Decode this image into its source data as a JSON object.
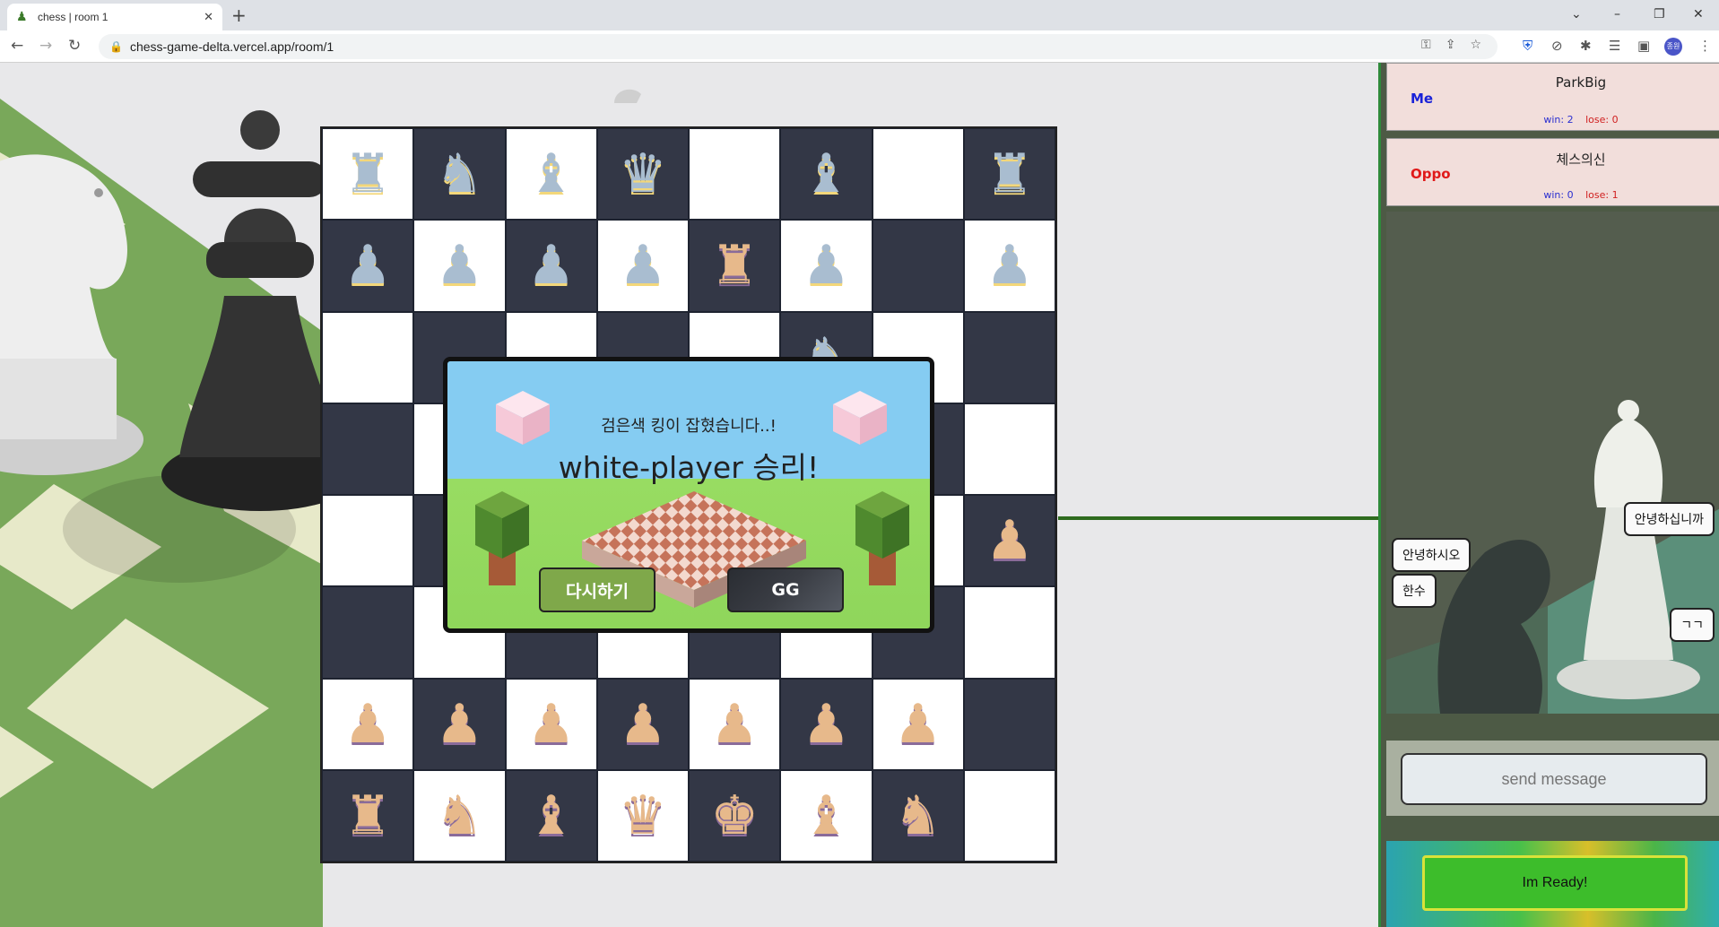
{
  "browser": {
    "tab_title": "chess | room 1",
    "url": "chess-game-delta.vercel.app/room/1",
    "avatar_text": "종원"
  },
  "board": {
    "rows": [
      [
        {
          "p": "♜",
          "c": "black"
        },
        {
          "p": "♞",
          "c": "black"
        },
        {
          "p": "♝",
          "c": "black"
        },
        {
          "p": "♛",
          "c": "black"
        },
        {
          "p": "",
          "c": ""
        },
        {
          "p": "♝",
          "c": "black"
        },
        {
          "p": "",
          "c": ""
        },
        {
          "p": "♜",
          "c": "black"
        }
      ],
      [
        {
          "p": "♟",
          "c": "black"
        },
        {
          "p": "♟",
          "c": "black"
        },
        {
          "p": "♟",
          "c": "black"
        },
        {
          "p": "♟",
          "c": "black"
        },
        {
          "p": "♜",
          "c": "white"
        },
        {
          "p": "♟",
          "c": "black"
        },
        {
          "p": "",
          "c": ""
        },
        {
          "p": "♟",
          "c": "black"
        }
      ],
      [
        {
          "p": "",
          "c": ""
        },
        {
          "p": "",
          "c": ""
        },
        {
          "p": "",
          "c": ""
        },
        {
          "p": "",
          "c": ""
        },
        {
          "p": "",
          "c": ""
        },
        {
          "p": "♞",
          "c": "black"
        },
        {
          "p": "",
          "c": ""
        },
        {
          "p": "",
          "c": ""
        }
      ],
      [
        {
          "p": "",
          "c": ""
        },
        {
          "p": "",
          "c": ""
        },
        {
          "p": "",
          "c": ""
        },
        {
          "p": "",
          "c": ""
        },
        {
          "p": "",
          "c": ""
        },
        {
          "p": "",
          "c": ""
        },
        {
          "p": "",
          "c": ""
        },
        {
          "p": "",
          "c": ""
        }
      ],
      [
        {
          "p": "",
          "c": ""
        },
        {
          "p": "",
          "c": ""
        },
        {
          "p": "",
          "c": ""
        },
        {
          "p": "",
          "c": ""
        },
        {
          "p": "",
          "c": ""
        },
        {
          "p": "",
          "c": ""
        },
        {
          "p": "",
          "c": ""
        },
        {
          "p": "♟",
          "c": "white"
        }
      ],
      [
        {
          "p": "",
          "c": ""
        },
        {
          "p": "",
          "c": ""
        },
        {
          "p": "",
          "c": ""
        },
        {
          "p": "",
          "c": ""
        },
        {
          "p": "",
          "c": ""
        },
        {
          "p": "",
          "c": ""
        },
        {
          "p": "",
          "c": ""
        },
        {
          "p": "",
          "c": ""
        }
      ],
      [
        {
          "p": "♟",
          "c": "white"
        },
        {
          "p": "♟",
          "c": "white"
        },
        {
          "p": "♟",
          "c": "white"
        },
        {
          "p": "♟",
          "c": "white"
        },
        {
          "p": "♟",
          "c": "white"
        },
        {
          "p": "♟",
          "c": "white"
        },
        {
          "p": "♟",
          "c": "white"
        },
        {
          "p": "",
          "c": ""
        }
      ],
      [
        {
          "p": "♜",
          "c": "white"
        },
        {
          "p": "♞",
          "c": "white"
        },
        {
          "p": "♝",
          "c": "white"
        },
        {
          "p": "♛",
          "c": "white"
        },
        {
          "p": "♚",
          "c": "white"
        },
        {
          "p": "♝",
          "c": "white"
        },
        {
          "p": "♞",
          "c": "white"
        },
        {
          "p": "",
          "c": ""
        }
      ]
    ]
  },
  "modal": {
    "subtitle": "검은색 킹이 잡혔습니다..!",
    "title": "white-player 승리!",
    "retry_label": "다시하기",
    "gg_label": "GG"
  },
  "players": {
    "me": {
      "role": "Me",
      "name": "ParkBig",
      "win": "win: 2",
      "lose": "lose: 0",
      "role_color": "#1a22d8"
    },
    "oppo": {
      "role": "Oppo",
      "name": "체스의신",
      "win": "win: 0",
      "lose": "lose: 1",
      "role_color": "#e01a1a"
    }
  },
  "chat": {
    "messages": [
      {
        "text": "안녕하십니까",
        "side": "right"
      },
      {
        "text": "안녕하시오",
        "side": "left"
      },
      {
        "text": "한수",
        "side": "left"
      },
      {
        "text": "ㄱㄱ",
        "side": "right"
      }
    ],
    "placeholder": "send message"
  },
  "ready": {
    "label": "Im Ready!"
  }
}
